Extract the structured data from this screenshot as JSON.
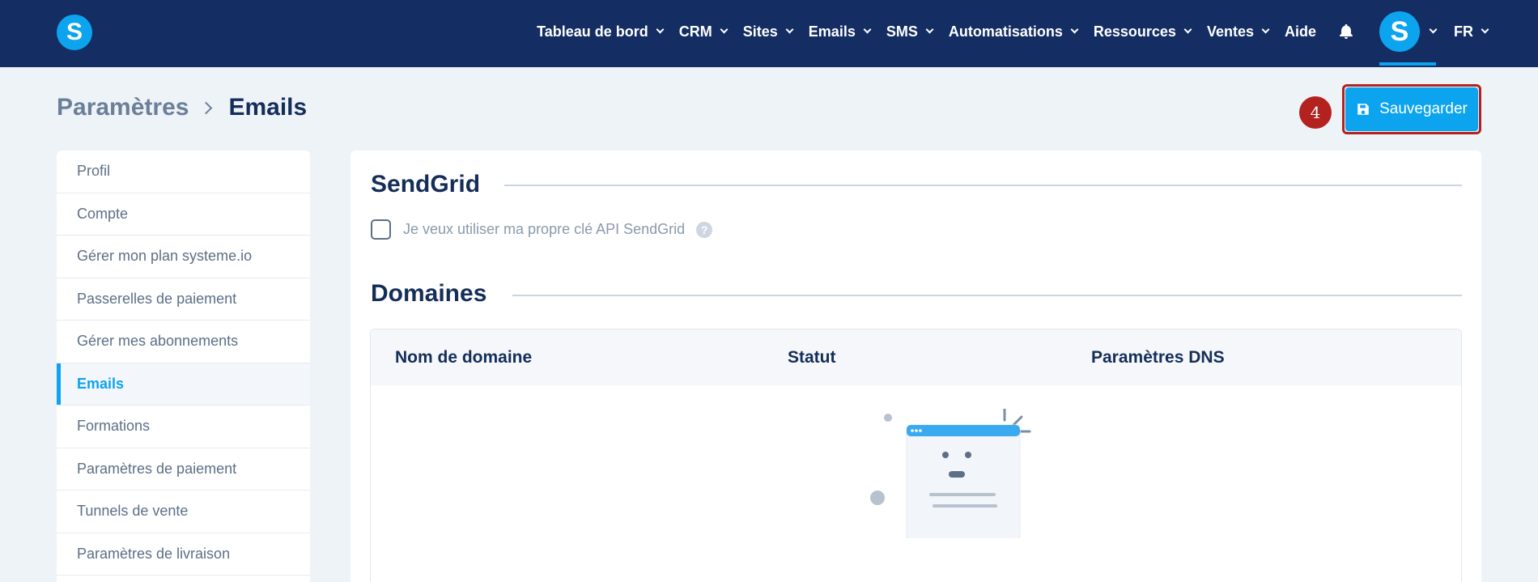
{
  "brand": {
    "logo_letter": "S",
    "accent": "#0ca3ef",
    "nav_bg": "#142e63",
    "highlight": "#b3221f"
  },
  "nav": {
    "items": [
      {
        "label": "Tableau de bord",
        "dropdown": true
      },
      {
        "label": "CRM",
        "dropdown": true
      },
      {
        "label": "Sites",
        "dropdown": true
      },
      {
        "label": "Emails",
        "dropdown": true
      },
      {
        "label": "SMS",
        "dropdown": true
      },
      {
        "label": "Automatisations",
        "dropdown": true
      },
      {
        "label": "Ressources",
        "dropdown": true
      },
      {
        "label": "Ventes",
        "dropdown": true
      },
      {
        "label": "Aide",
        "dropdown": false
      }
    ],
    "bell_icon": "bell-icon",
    "avatar_letter": "S",
    "language": "FR"
  },
  "breadcrumb": {
    "parent": "Paramètres",
    "current": "Emails"
  },
  "step_badge": "4",
  "toolbar": {
    "save_label": "Sauvegarder",
    "save_icon": "floppy-disk-icon"
  },
  "sidebar": {
    "items": [
      {
        "label": "Profil",
        "active": false
      },
      {
        "label": "Compte",
        "active": false
      },
      {
        "label": "Gérer mon plan systeme.io",
        "active": false
      },
      {
        "label": "Passerelles de paiement",
        "active": false
      },
      {
        "label": "Gérer mes abonnements",
        "active": false
      },
      {
        "label": "Emails",
        "active": true
      },
      {
        "label": "Formations",
        "active": false
      },
      {
        "label": "Paramètres de paiement",
        "active": false
      },
      {
        "label": "Tunnels de vente",
        "active": false
      },
      {
        "label": "Paramètres de livraison",
        "active": false
      }
    ]
  },
  "sendgrid": {
    "title": "SendGrid",
    "checkbox_label": "Je veux utiliser ma propre clé API SendGrid",
    "checked": false,
    "help_glyph": "?"
  },
  "domains": {
    "title": "Domaines",
    "columns": [
      "Nom de domaine",
      "Statut",
      "Paramètres DNS"
    ],
    "rows": []
  }
}
